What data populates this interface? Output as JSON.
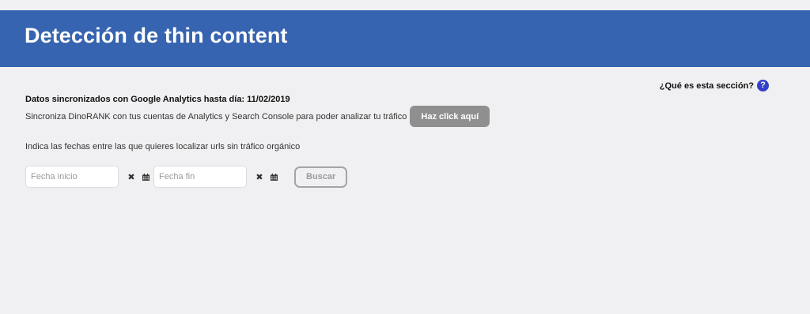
{
  "header": {
    "title": "Detección de thin content",
    "bg_color": "#3664b0"
  },
  "help": {
    "label": "¿Qué es esta sección?",
    "icon": "question-icon",
    "icon_glyph": "?"
  },
  "sync": {
    "title": "Datos sincronizados con Google Analytics hasta día: 11/02/2019",
    "description": "Sincroniza DinoRANK con tus cuentas de Analytics y Search Console para poder analizar tu tráfico",
    "button_label": "Haz click aquí"
  },
  "dates": {
    "label": "Indica las fechas entre las que quieres localizar urls sin tráfico orgánico",
    "start": {
      "placeholder": "Fecha inicio",
      "value": ""
    },
    "end": {
      "placeholder": "Fecha fin",
      "value": ""
    },
    "clear_icon": "close-icon",
    "clear_glyph": "✖",
    "calendar_icon": "calendar-icon",
    "search_label": "Buscar"
  }
}
